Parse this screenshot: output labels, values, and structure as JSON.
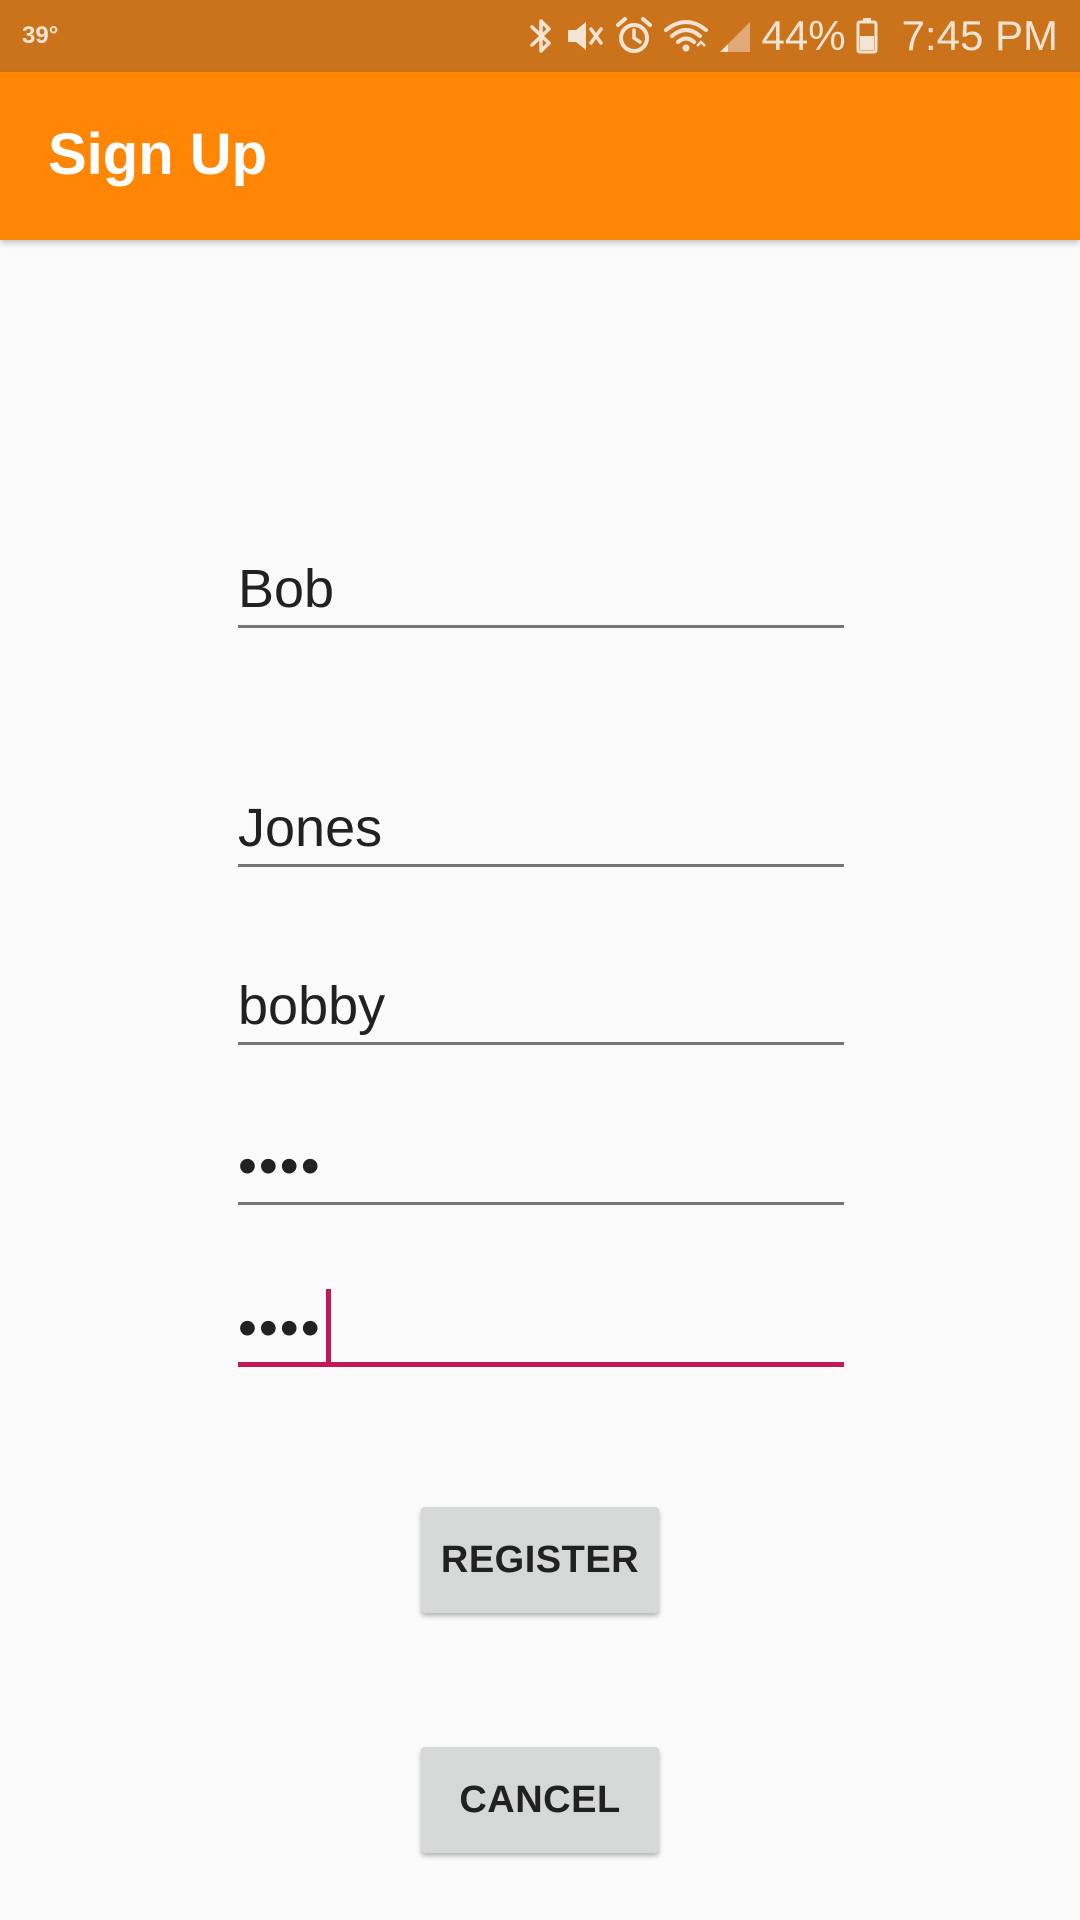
{
  "status_bar": {
    "temperature": "39°",
    "battery": "44%",
    "time": "7:45 PM",
    "icons": [
      "bluetooth-icon",
      "vibrate-mute-icon",
      "alarm-icon",
      "wifi-icon",
      "cell-signal-icon",
      "battery-icon"
    ],
    "color": "#CB731B"
  },
  "app_bar": {
    "title": "Sign Up",
    "color": "#FF8504"
  },
  "form": {
    "first_name": {
      "value": "Bob"
    },
    "last_name": {
      "value": "Jones"
    },
    "username": {
      "value": "bobby"
    },
    "password": {
      "value": "••••"
    },
    "confirm_password": {
      "value": "••••",
      "focused": true
    }
  },
  "buttons": {
    "register_label": "REGISTER",
    "cancel_label": "CANCEL"
  },
  "colors": {
    "accent": "#C2185B",
    "background": "#FAFAFA",
    "button": "#D6D7D7"
  }
}
